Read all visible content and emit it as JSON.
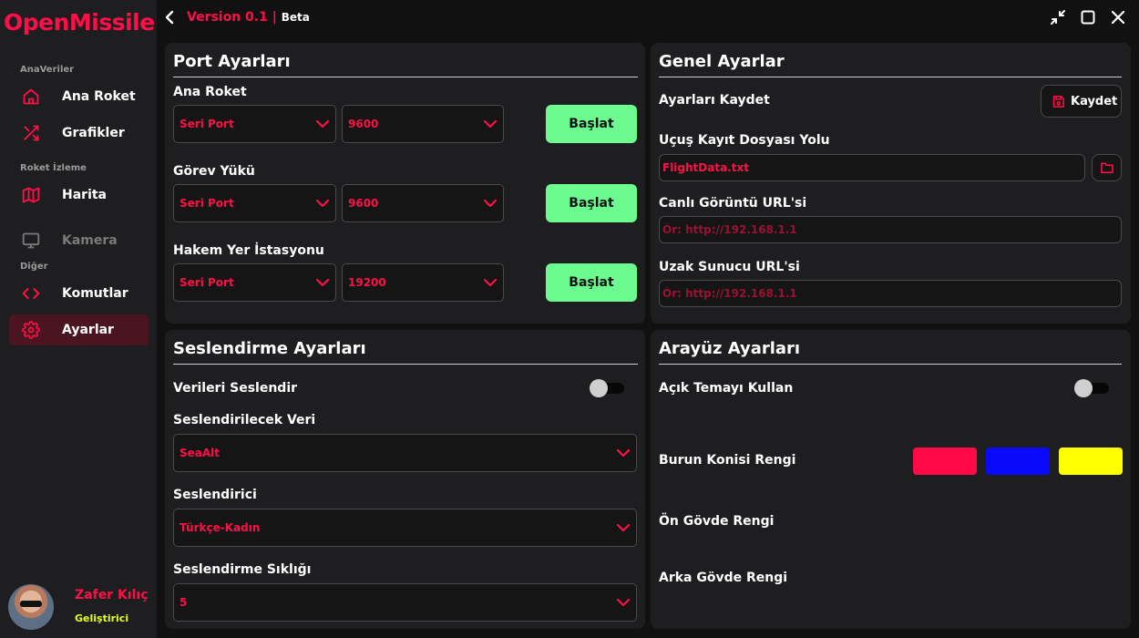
{
  "app": {
    "logo": "OpenMissile",
    "version": "Version 0.1",
    "version_sep": " | ",
    "channel": "Beta"
  },
  "sidebar": {
    "sections": [
      "AnaVeriler",
      "Roket İzleme",
      "Diğer"
    ],
    "items": [
      {
        "label": "Ana Roket",
        "icon": "home-icon"
      },
      {
        "label": "Grafikler",
        "icon": "shuffle-icon"
      },
      {
        "label": "Harita",
        "icon": "map-icon"
      },
      {
        "label": "Kamera",
        "icon": "monitor-icon"
      },
      {
        "label": "Komutlar",
        "icon": "code-icon"
      },
      {
        "label": "Ayarlar",
        "icon": "gear-icon"
      }
    ],
    "active": "Ayarlar",
    "user": {
      "name": "Zafer Kılıç",
      "role": "Geliştirici"
    }
  },
  "port": {
    "title": "Port Ayarları",
    "groups": [
      {
        "label": "Ana Roket",
        "port": "Seri Port",
        "baud": "9600",
        "button": "Başlat"
      },
      {
        "label": "Görev Yükü",
        "port": "Seri Port",
        "baud": "9600",
        "button": "Başlat"
      },
      {
        "label": "Hakem Yer İstasyonu",
        "port": "Seri Port",
        "baud": "19200",
        "button": "Başlat"
      }
    ]
  },
  "general": {
    "title": "Genel Ayarlar",
    "save_label": "Ayarları Kaydet",
    "save_button": "Kaydet",
    "log_label": "Uçuş Kayıt Dosyası Yolu",
    "log_value": "FlightData.txt",
    "live_label": "Canlı Görüntü URL'si",
    "live_placeholder": "Ör: http://192.168.1.1",
    "remote_label": "Uzak Sunucu URL'si",
    "remote_placeholder": "Ör: http://192.168.1.1"
  },
  "speech": {
    "title": "Seslendirme Ayarları",
    "toggle_label": "Verileri Seslendir",
    "toggle_on": false,
    "data_label": "Seslendirilecek Veri",
    "data_value": "SeaAlt",
    "voice_label": "Seslendirici",
    "voice_value": "Türkçe-Kadın",
    "freq_label": "Seslendirme Sıklığı",
    "freq_value": "5"
  },
  "ui": {
    "title": "Arayüz Ayarları",
    "theme_label": "Açık Temayı Kullan",
    "theme_on": false,
    "nose_label": "Burun Konisi Rengi",
    "front_label": "Ön Gövde Rengi",
    "rear_label": "Arka Gövde Rengi",
    "colors": [
      "#ff0a47",
      "#0a0afa",
      "#ffff00"
    ]
  },
  "theme": {
    "accent": "#ff0f47",
    "green": "#6bfb8e",
    "role": "#e4ff1a"
  }
}
